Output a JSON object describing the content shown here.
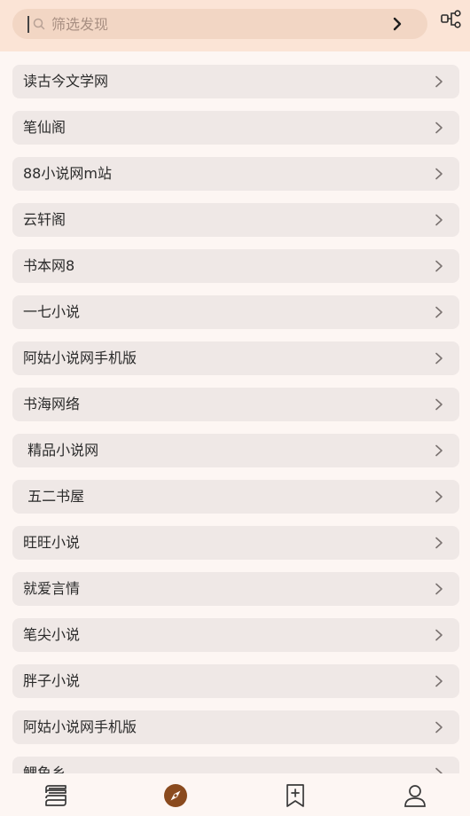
{
  "search": {
    "placeholder": "筛选发现",
    "value": ""
  },
  "icons": {
    "search": "search-icon",
    "go": "chevron-right-icon",
    "share": "share-nodes-icon",
    "item_arrow": "chevron-right-icon"
  },
  "colors": {
    "topbar_bg": "#fbe4d6",
    "search_bg": "#f2d6c4",
    "item_bg": "#efe8e6",
    "accent": "#8a4a1e"
  },
  "sources": [
    "读古今文学网",
    "笔仙阁",
    "88小说网m站",
    "云轩阁",
    "书本网8",
    "一七小说",
    "阿姑小说网手机版",
    "书海网络",
    " 精品小说网",
    " 五二书屋",
    "旺旺小说",
    "就爱言情",
    "笔尖小说",
    "胖子小说",
    "阿姑小说网手机版",
    "鲤鱼乡"
  ],
  "tabbar": {
    "tabs": [
      {
        "name": "bookshelf",
        "icon": "bookshelf-icon",
        "active": false
      },
      {
        "name": "explore",
        "icon": "compass-icon",
        "active": true
      },
      {
        "name": "subscription",
        "icon": "bookmark-add-icon",
        "active": false
      },
      {
        "name": "profile",
        "icon": "person-icon",
        "active": false
      }
    ]
  }
}
